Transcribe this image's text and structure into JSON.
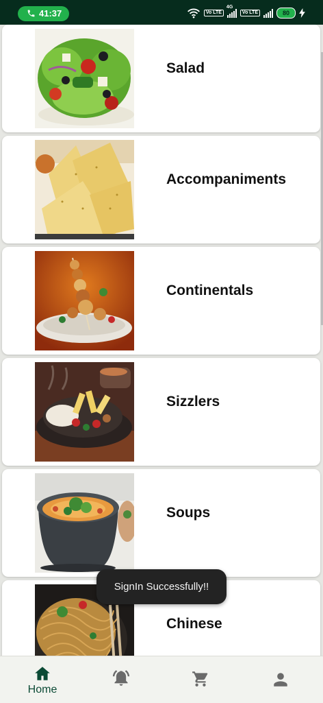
{
  "status_bar": {
    "time": "41:37",
    "volte_label_1": "Vo LTE",
    "network_label": "4G",
    "volte_label_2": "Vo LTE",
    "battery": "80"
  },
  "categories": [
    {
      "label": "Salad"
    },
    {
      "label": "Accompaniments"
    },
    {
      "label": "Continentals"
    },
    {
      "label": "Sizzlers"
    },
    {
      "label": "Soups"
    },
    {
      "label": "Chinese"
    }
  ],
  "toast": {
    "text": "SignIn Successfully!!"
  },
  "bottom_nav": {
    "home_label": "Home"
  },
  "colors": {
    "status_bar": "#062c1d",
    "accent": "#0b4a35",
    "call_pill": "#22b14c",
    "background": "#e6e7e3"
  }
}
